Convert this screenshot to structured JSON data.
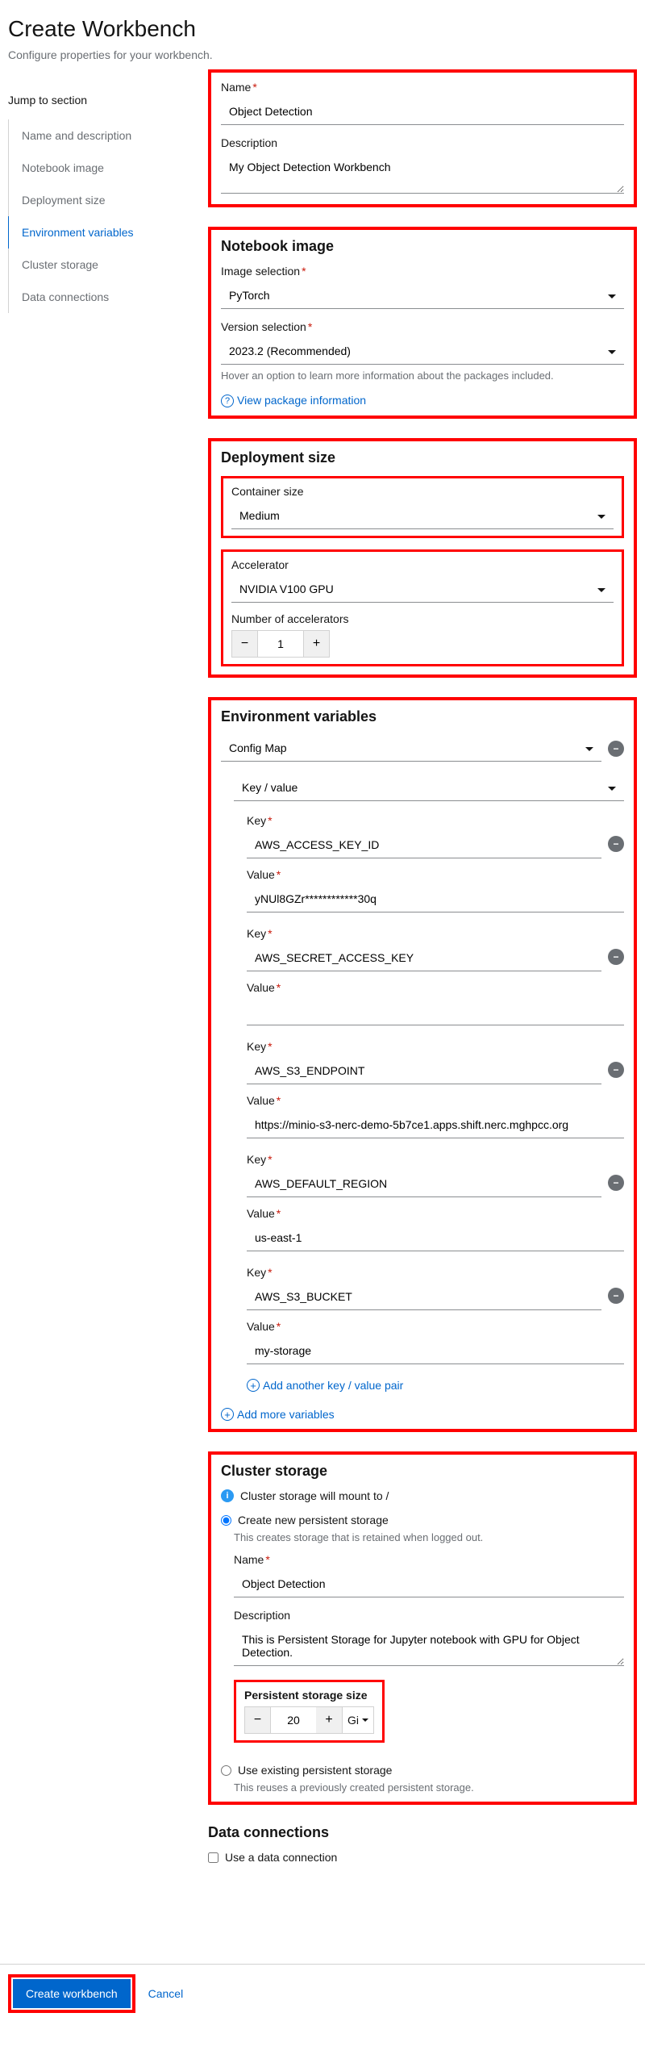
{
  "header": {
    "title": "Create Workbench",
    "subtitle": "Configure properties for your workbench."
  },
  "jump_nav": {
    "title": "Jump to section",
    "items": [
      {
        "label": "Name and description",
        "active": false
      },
      {
        "label": "Notebook image",
        "active": false
      },
      {
        "label": "Deployment size",
        "active": false
      },
      {
        "label": "Environment variables",
        "active": true
      },
      {
        "label": "Cluster storage",
        "active": false
      },
      {
        "label": "Data connections",
        "active": false
      }
    ]
  },
  "name_section": {
    "name_label": "Name",
    "name_value": "Object Detection",
    "desc_label": "Description",
    "desc_value": "My Object Detection Workbench"
  },
  "notebook_image": {
    "title": "Notebook image",
    "image_label": "Image selection",
    "image_value": "PyTorch",
    "version_label": "Version selection",
    "version_value": "2023.2 (Recommended)",
    "helper": "Hover an option to learn more information about the packages included.",
    "link": "View package information"
  },
  "deployment_size": {
    "title": "Deployment size",
    "container_label": "Container size",
    "container_value": "Medium",
    "accelerator_label": "Accelerator",
    "accelerator_value": "NVIDIA V100 GPU",
    "num_label": "Number of accelerators",
    "num_value": "1"
  },
  "env_vars": {
    "title": "Environment variables",
    "type_value": "Config Map",
    "subtype_value": "Key / value",
    "key_label": "Key",
    "value_label": "Value",
    "pairs": [
      {
        "key": "AWS_ACCESS_KEY_ID",
        "value": "yNUl8GZr************30q"
      },
      {
        "key": "AWS_SECRET_ACCESS_KEY",
        "value": ""
      },
      {
        "key": "AWS_S3_ENDPOINT",
        "value": "https://minio-s3-nerc-demo-5b7ce1.apps.shift.nerc.mghpcc.org"
      },
      {
        "key": "AWS_DEFAULT_REGION",
        "value": "us-east-1"
      },
      {
        "key": "AWS_S3_BUCKET",
        "value": "my-storage"
      }
    ],
    "add_pair": "Add another key / value pair",
    "add_more": "Add more variables"
  },
  "cluster_storage": {
    "title": "Cluster storage",
    "mount_info": "Cluster storage will mount to /",
    "create_new_label": "Create new persistent storage",
    "create_new_helper": "This creates storage that is retained when logged out.",
    "name_label": "Name",
    "name_value": "Object Detection",
    "desc_label": "Description",
    "desc_value": "This is Persistent Storage for Jupyter notebook with GPU for Object Detection.",
    "size_label": "Persistent storage size",
    "size_value": "20",
    "size_unit": "Gi",
    "existing_label": "Use existing persistent storage",
    "existing_helper": "This reuses a previously created persistent storage."
  },
  "data_connections": {
    "title": "Data connections",
    "checkbox_label": "Use a data connection"
  },
  "footer": {
    "create": "Create workbench",
    "cancel": "Cancel"
  }
}
